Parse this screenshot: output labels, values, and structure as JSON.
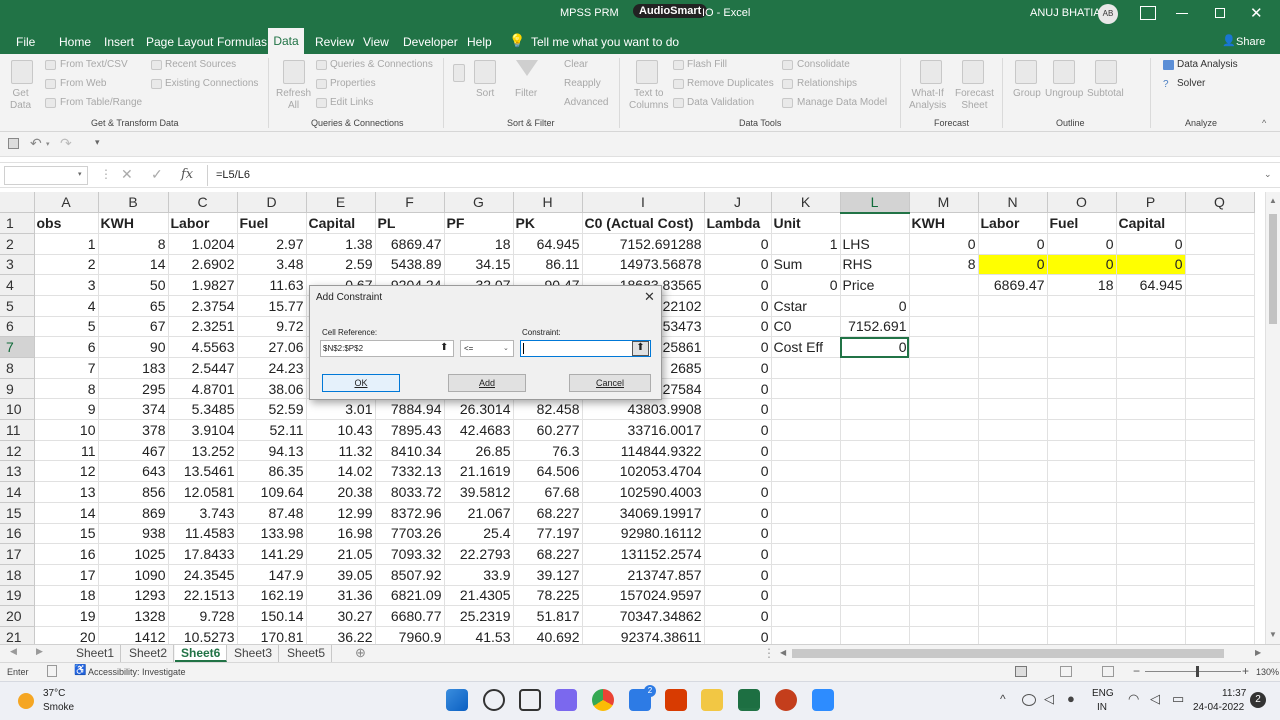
{
  "window": {
    "title_left": "MPSS PRM",
    "title_badge": "AudioSmart",
    "title_right": "IO  -  Excel",
    "user": "ANUJ BHATIA",
    "avatar": "AB"
  },
  "menu": {
    "items": [
      "File",
      "Home",
      "Insert",
      "Page Layout",
      "Formulas",
      "Data",
      "Review",
      "View",
      "Developer",
      "Help"
    ],
    "active": "Data",
    "tell_me": "Tell me what you want to do",
    "share": "Share"
  },
  "ribbon": {
    "get_data": "Get\nData",
    "from_text": "From Text/CSV",
    "from_web": "From Web",
    "from_table": "From Table/Range",
    "recent_sources": "Recent Sources",
    "existing_connections": "Existing Connections",
    "group_get_transform": "Get & Transform Data",
    "refresh_all": "Refresh\nAll",
    "queries_connections": "Queries & Connections",
    "properties": "Properties",
    "edit_links": "Edit Links",
    "group_queries": "Queries & Connections",
    "sort": "Sort",
    "filter": "Filter",
    "clear": "Clear",
    "reapply": "Reapply",
    "advanced": "Advanced",
    "group_sort_filter": "Sort & Filter",
    "text_to_columns": "Text to\nColumns",
    "flash_fill": "Flash Fill",
    "remove_duplicates": "Remove Duplicates",
    "data_validation": "Data Validation",
    "consolidate": "Consolidate",
    "relationships": "Relationships",
    "manage_data_model": "Manage Data Model",
    "group_data_tools": "Data Tools",
    "what_if": "What-If\nAnalysis",
    "forecast_sheet": "Forecast\nSheet",
    "group_forecast": "Forecast",
    "group": "Group",
    "ungroup": "Ungroup",
    "subtotal": "Subtotal",
    "group_outline": "Outline",
    "data_analysis": "Data Analysis",
    "solver": "Solver",
    "group_analyze": "Analyze"
  },
  "formula_bar": {
    "name_box": "",
    "formula": "=L5/L6",
    "fx": "fx"
  },
  "columns": [
    "A",
    "B",
    "C",
    "D",
    "E",
    "F",
    "G",
    "H",
    "I",
    "J",
    "K",
    "L",
    "M",
    "N",
    "O",
    "P",
    "Q"
  ],
  "rows": [
    [
      "obs",
      "KWH",
      "Labor",
      "Fuel",
      "Capital",
      "PL",
      "PF",
      "PK",
      "C0 (Actual Cost)",
      "Lambda",
      "Unit",
      "",
      "KWH",
      "Labor",
      "Fuel",
      "Capital",
      ""
    ],
    [
      "1",
      "8",
      "1.0204",
      "2.97",
      "1.38",
      "6869.47",
      "18",
      "64.945",
      "7152.691288",
      "0",
      "1",
      "LHS",
      "0",
      "0",
      "0",
      "0",
      ""
    ],
    [
      "2",
      "14",
      "2.6902",
      "3.48",
      "2.59",
      "5438.89",
      "34.15",
      "86.11",
      "14973.56878",
      "0",
      "Sum",
      "RHS",
      "8",
      "0",
      "0",
      "0",
      ""
    ],
    [
      "3",
      "50",
      "1.9827",
      "11.63",
      "0.67",
      "9204.24",
      "32.07",
      "90.47",
      "18683.83565",
      "0",
      "0",
      "Price",
      "",
      "6869.47",
      "18",
      "64.945",
      ""
    ],
    [
      "4",
      "65",
      "2.3754",
      "15.77",
      "",
      "",
      "",
      "",
      "22102",
      "0",
      "Cstar",
      "0",
      "",
      "",
      "",
      "",
      ""
    ],
    [
      "5",
      "67",
      "2.3251",
      "9.72",
      "",
      "",
      "",
      "",
      "53473",
      "0",
      "C0",
      "7152.691",
      "",
      "",
      "",
      "",
      ""
    ],
    [
      "6",
      "90",
      "4.5563",
      "27.06",
      "",
      "",
      "",
      "",
      "25861",
      "0",
      "Cost Eff",
      "0",
      "",
      "",
      "",
      "",
      ""
    ],
    [
      "7",
      "183",
      "2.5447",
      "24.23",
      "",
      "",
      "",
      "",
      "2685",
      "0",
      "",
      "",
      "",
      "",
      "",
      "",
      ""
    ],
    [
      "8",
      "295",
      "4.8701",
      "38.06",
      "",
      "",
      "",
      "",
      "27584",
      "0",
      "",
      "",
      "",
      "",
      "",
      "",
      ""
    ],
    [
      "9",
      "374",
      "5.3485",
      "52.59",
      "3.01",
      "7884.94",
      "26.3014",
      "82.458",
      "43803.9908",
      "0",
      "",
      "",
      "",
      "",
      "",
      "",
      ""
    ],
    [
      "10",
      "378",
      "3.9104",
      "52.11",
      "10.43",
      "7895.43",
      "42.4683",
      "60.277",
      "33716.0017",
      "0",
      "",
      "",
      "",
      "",
      "",
      "",
      ""
    ],
    [
      "11",
      "467",
      "13.252",
      "94.13",
      "11.32",
      "8410.34",
      "26.85",
      "76.3",
      "114844.9322",
      "0",
      "",
      "",
      "",
      "",
      "",
      "",
      ""
    ],
    [
      "12",
      "643",
      "13.5461",
      "86.35",
      "14.02",
      "7332.13",
      "21.1619",
      "64.506",
      "102053.4704",
      "0",
      "",
      "",
      "",
      "",
      "",
      "",
      ""
    ],
    [
      "13",
      "856",
      "12.0581",
      "109.64",
      "20.38",
      "8033.72",
      "39.5812",
      "67.68",
      "102590.4003",
      "0",
      "",
      "",
      "",
      "",
      "",
      "",
      ""
    ],
    [
      "14",
      "869",
      "3.743",
      "87.48",
      "12.99",
      "8372.96",
      "21.067",
      "68.227",
      "34069.19917",
      "0",
      "",
      "",
      "",
      "",
      "",
      "",
      ""
    ],
    [
      "15",
      "938",
      "11.4583",
      "133.98",
      "16.98",
      "7703.26",
      "25.4",
      "77.197",
      "92980.16112",
      "0",
      "",
      "",
      "",
      "",
      "",
      "",
      ""
    ],
    [
      "16",
      "1025",
      "17.8433",
      "141.29",
      "21.05",
      "7093.32",
      "22.2793",
      "68.227",
      "131152.2574",
      "0",
      "",
      "",
      "",
      "",
      "",
      "",
      ""
    ],
    [
      "17",
      "1090",
      "24.3545",
      "147.9",
      "39.05",
      "8507.92",
      "33.9",
      "39.127",
      "213747.857",
      "0",
      "",
      "",
      "",
      "",
      "",
      "",
      ""
    ],
    [
      "18",
      "1293",
      "22.1513",
      "162.19",
      "31.36",
      "6821.09",
      "21.4305",
      "78.225",
      "157024.9597",
      "0",
      "",
      "",
      "",
      "",
      "",
      "",
      ""
    ],
    [
      "19",
      "1328",
      "9.728",
      "150.14",
      "30.27",
      "6680.77",
      "25.2319",
      "51.817",
      "70347.34862",
      "0",
      "",
      "",
      "",
      "",
      "",
      "",
      ""
    ],
    [
      "20",
      "1412",
      "10.5273",
      "170.81",
      "36.22",
      "7960.9",
      "41.53",
      "40.692",
      "92374.38611",
      "0",
      "",
      "",
      "",
      "",
      "",
      "",
      ""
    ]
  ],
  "sheets": [
    "Sheet1",
    "Sheet2",
    "Sheet6",
    "Sheet3",
    "Sheet5"
  ],
  "active_sheet": "Sheet6",
  "status": {
    "mode": "Enter",
    "accessibility": "Accessibility: Investigate",
    "zoom": "130%"
  },
  "dialog": {
    "title": "Add Constraint",
    "cell_ref_label": "Cell Reference:",
    "cell_ref_value": "$N$2:$P$2",
    "operator": "<=",
    "constraint_label": "Constraint:",
    "constraint_value": "",
    "ok": "OK",
    "add": "Add",
    "cancel": "Cancel"
  },
  "taskbar": {
    "temp": "37°C",
    "weather": "Smoke",
    "lang1": "ENG",
    "lang2": "IN",
    "time": "11:37",
    "date": "24-04-2022",
    "notif": "2",
    "badge": "2"
  },
  "colors": {
    "excel_green": "#217346",
    "highlight_yellow": "#ffff00"
  }
}
